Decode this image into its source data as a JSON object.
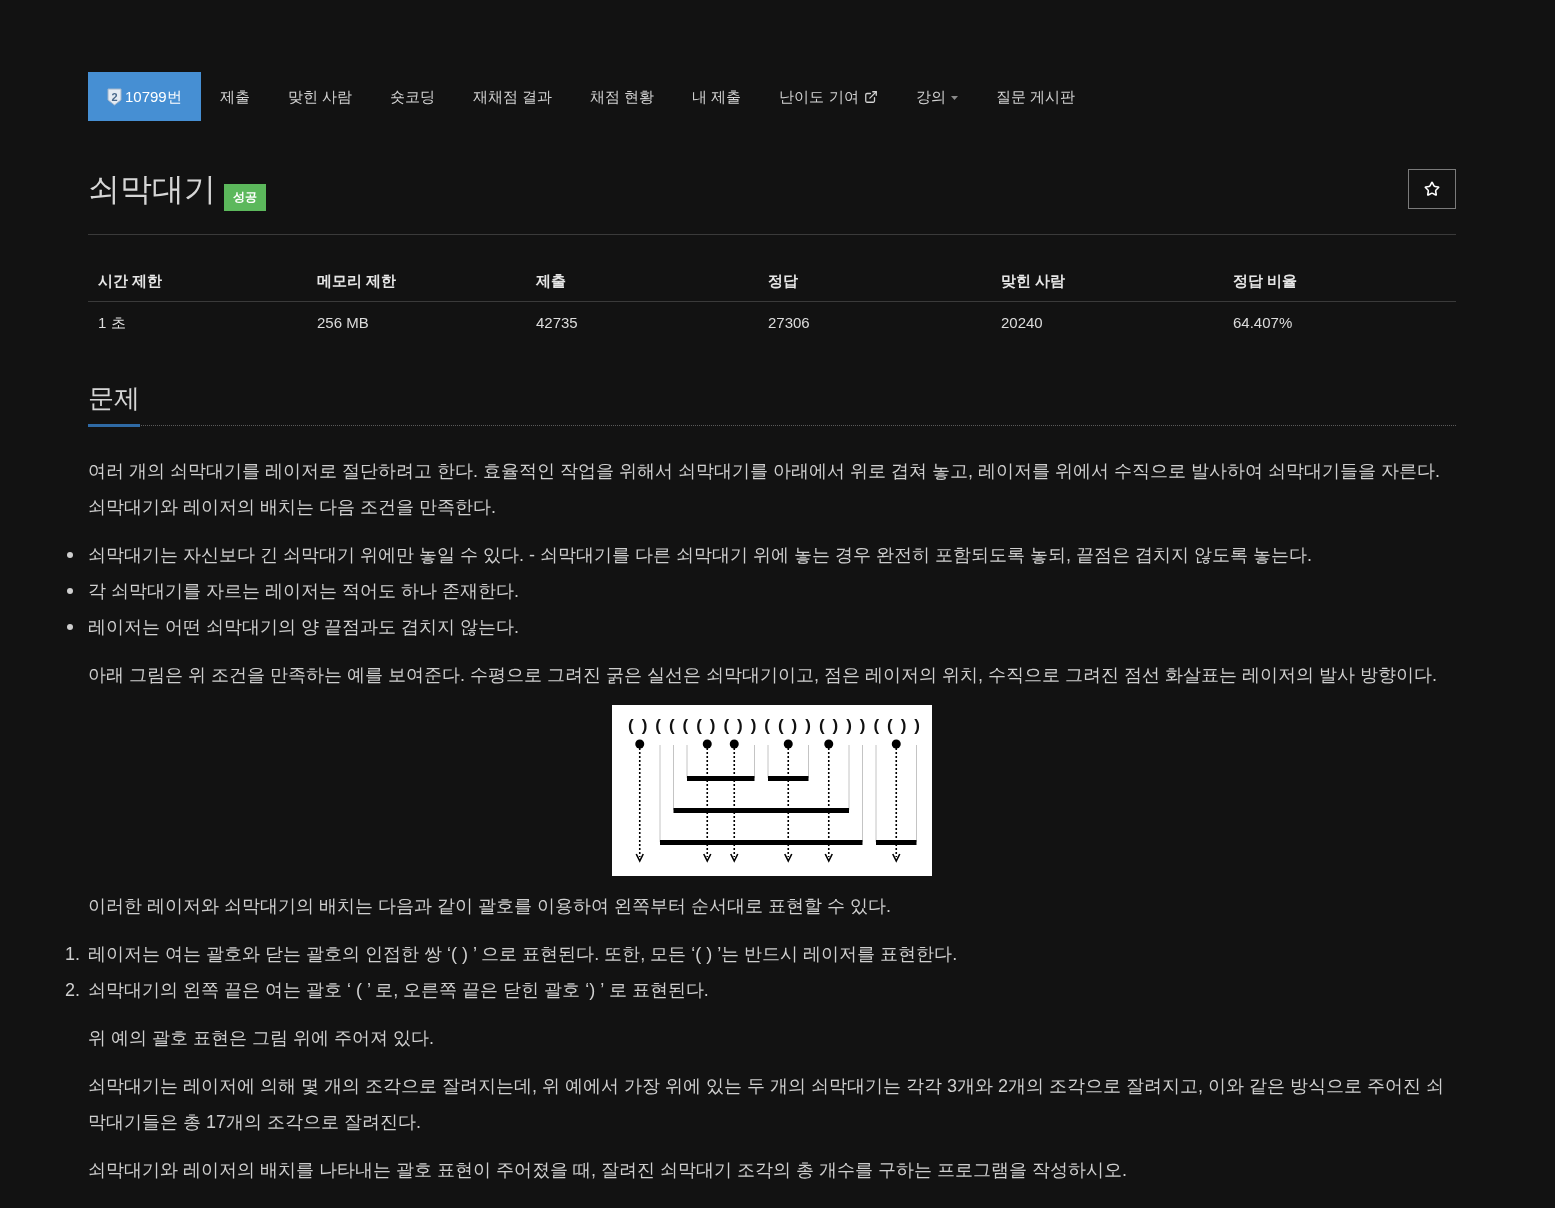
{
  "nav": {
    "tabs": [
      {
        "label": "10799번",
        "selected": true,
        "kind": "plain",
        "badge": "2"
      },
      {
        "label": "제출",
        "selected": false,
        "kind": "plain"
      },
      {
        "label": "맞힌 사람",
        "selected": false,
        "kind": "plain"
      },
      {
        "label": "숏코딩",
        "selected": false,
        "kind": "plain"
      },
      {
        "label": "재채점 결과",
        "selected": false,
        "kind": "plain"
      },
      {
        "label": "채점 현황",
        "selected": false,
        "kind": "plain"
      },
      {
        "label": "내 제출",
        "selected": false,
        "kind": "plain"
      },
      {
        "label": "난이도 기여",
        "selected": false,
        "kind": "external"
      },
      {
        "label": "강의",
        "selected": false,
        "kind": "dropdown"
      },
      {
        "label": "질문 게시판",
        "selected": false,
        "kind": "plain"
      }
    ]
  },
  "problem": {
    "title": "쇠막대기",
    "status": "성공",
    "starred": false
  },
  "limits_table": {
    "columns": [
      "시간 제한",
      "메모리 제한",
      "제출",
      "정답",
      "맞힌 사람",
      "정답 비율"
    ],
    "rows": [
      [
        "1 초",
        "256 MB",
        "42735",
        "27306",
        "20240",
        "64.407%"
      ]
    ]
  },
  "section": {
    "heading": "문제",
    "content": [
      {
        "kind": "paragraph",
        "text": "여러 개의 쇠막대기를 레이저로 절단하려고 한다. 효율적인 작업을 위해서 쇠막대기를 아래에서 위로 겹쳐 놓고, 레이저를 위에서 수직으로 발사하여 쇠막대기들을 자른다. 쇠막대기와 레이저의 배치는 다음 조건을 만족한다."
      },
      {
        "kind": "bullets",
        "items": [
          "쇠막대기는 자신보다 긴 쇠막대기 위에만 놓일 수 있다. - 쇠막대기를 다른 쇠막대기 위에 놓는 경우 완전히 포함되도록 놓되, 끝점은 겹치지 않도록 놓는다.",
          "각 쇠막대기를 자르는 레이저는 적어도 하나 존재한다.",
          "레이저는 어떤 쇠막대기의 양 끝점과도 겹치지 않는다."
        ]
      },
      {
        "kind": "paragraph",
        "text": "아래 그림은 위 조건을 만족하는 예를 보여준다. 수평으로 그려진 굵은 실선은 쇠막대기이고, 점은 레이저의 위치, 수직으로 그려진 점선 화살표는 레이저의 발사 방향이다."
      },
      {
        "kind": "figure",
        "brackets": "( ) ( ( ( ( ) ( ) ) ( ( ) ) ( ) ) ) ( ( ) )"
      },
      {
        "kind": "paragraph",
        "text": "이러한 레이저와 쇠막대기의 배치는 다음과 같이 괄호를 이용하여 왼쪽부터 순서대로 표현할 수 있다."
      },
      {
        "kind": "numbered",
        "items": [
          {
            "number": "1.",
            "text": "레이저는 여는 괄호와 닫는 괄호의 인접한 쌍 ‘( ) ’ 으로 표현된다. 또한, 모든 ‘( ) ’는 반드시 레이저를 표현한다."
          },
          {
            "number": "2.",
            "text": "쇠막대기의 왼쪽 끝은 여는 괄호 ‘ ( ’ 로, 오른쪽 끝은 닫힌 괄호 ‘) ’ 로 표현된다."
          }
        ]
      },
      {
        "kind": "paragraph",
        "text": "위 예의 괄호 표현은 그림 위에 주어져 있다."
      },
      {
        "kind": "paragraph",
        "text": "쇠막대기는 레이저에 의해 몇 개의 조각으로 잘려지는데, 위 예에서 가장 위에 있는 두 개의 쇠막대기는 각각 3개와 2개의 조각으로 잘려지고, 이와 같은 방식으로 주어진 쇠막대기들은 총 17개의 조각으로 잘려진다."
      },
      {
        "kind": "paragraph",
        "text": "쇠막대기와 레이저의 배치를 나타내는 괄호 표현이 주어졌을 때, 잘려진 쇠막대기 조각의 총 개수를 구하는 프로그램을 작성하시오."
      }
    ]
  }
}
